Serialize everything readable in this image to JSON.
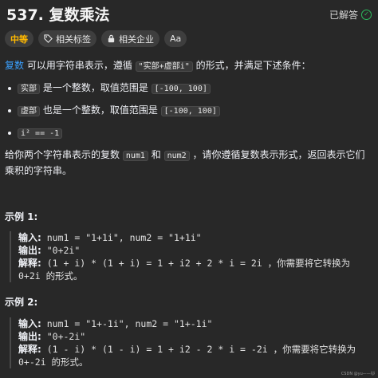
{
  "header": {
    "title": "537. 复数乘法",
    "solved_label": "已解答"
  },
  "tags": {
    "difficulty": "中等",
    "related_tags": "相关标签",
    "related_companies": "相关企业",
    "font_size_label": "Aa"
  },
  "description": {
    "intro_link": "复数",
    "intro_a": " 可以用字符串表示，遵循 ",
    "intro_code": "\"实部+虚部i\"",
    "intro_b": " 的形式，并满足下述条件：",
    "bullet1_code": "实部",
    "bullet1_a": " 是一个整数，取值范围是 ",
    "bullet1_range": "[-100, 100]",
    "bullet2_code": "虚部",
    "bullet2_a": " 也是一个整数，取值范围是 ",
    "bullet2_range": "[-100, 100]",
    "bullet3": "i² == -1",
    "para2_a": "给你两个字符串表示的复数 ",
    "para2_num1": "num1",
    "para2_and": " 和 ",
    "para2_num2": "num2",
    "para2_b": " ，请你遵循复数表示形式，返回表示它们乘积的字符串。"
  },
  "examples": [
    {
      "title": "示例 1:",
      "input_label": "输入:",
      "input_value": " num1 = \"1+1i\", num2 = \"1+1i\"",
      "output_label": "输出:",
      "output_value": " \"0+2i\"",
      "explain_label": "解释:",
      "explain_value": " (1 + i) * (1 + i) = 1 + i2 + 2 * i = 2i ，你需要将它转换为 0+2i 的形式。"
    },
    {
      "title": "示例 2:",
      "input_label": "输入:",
      "input_value": " num1 = \"1+-1i\", num2 = \"1+-1i\"",
      "output_label": "输出:",
      "output_value": " \"0+-2i\"",
      "explain_label": "解释:",
      "explain_value": " (1 - i) * (1 - i) = 1 + i2 - 2 * i = -2i ，你需要将它转换为 0+-2i 的形式。"
    }
  ],
  "watermark": "CSDN @yu——🐱"
}
